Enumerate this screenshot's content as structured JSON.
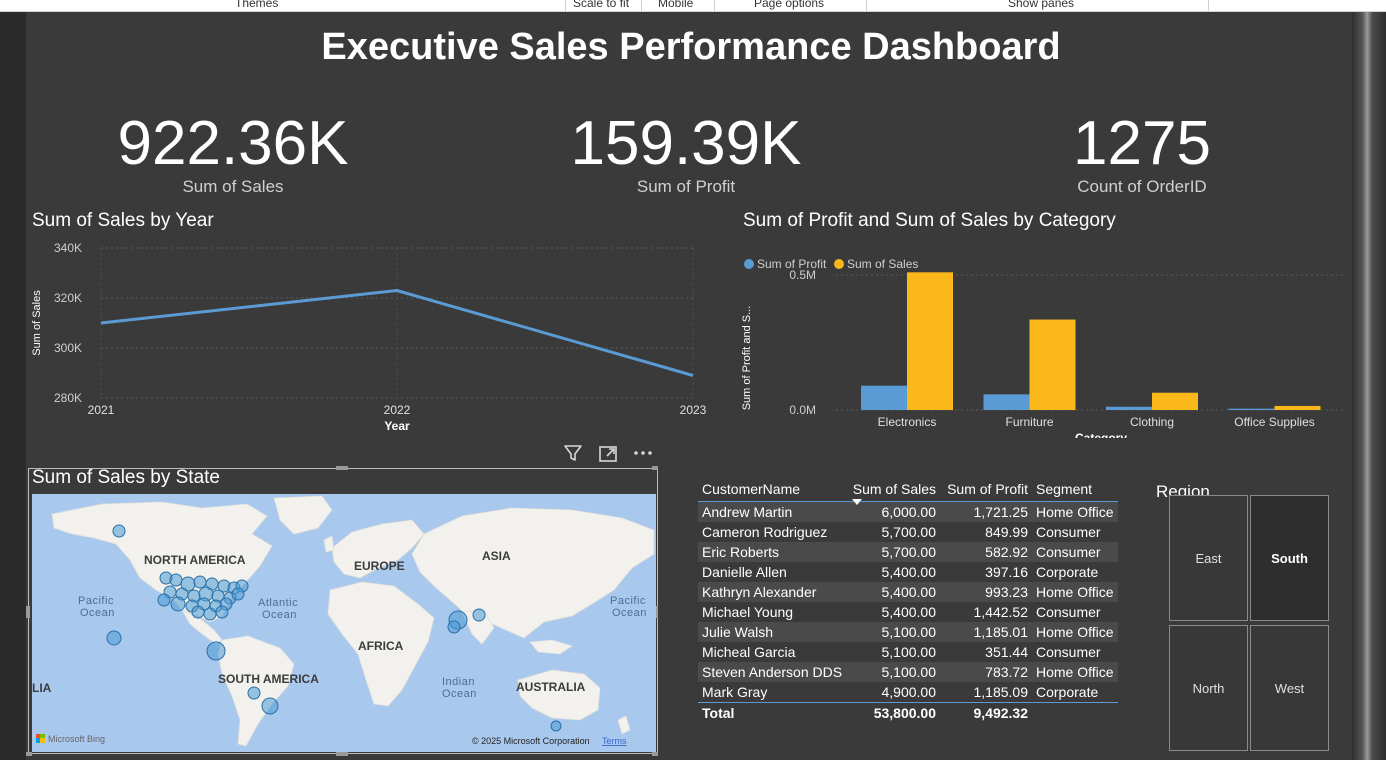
{
  "ribbon": {
    "items": [
      "Themes",
      "Scale to fit",
      "Mobile",
      "Page options",
      "Show panes"
    ]
  },
  "dashboard": {
    "title": "Executive Sales Performance Dashboard"
  },
  "kpis": [
    {
      "value": "922.36K",
      "label": "Sum of Sales"
    },
    {
      "value": "159.39K",
      "label": "Sum of Profit"
    },
    {
      "value": "1275",
      "label": "Count of OrderID"
    }
  ],
  "line_chart": {
    "title": "Sum of Sales by Year",
    "chart_data": {
      "type": "line",
      "x": [
        "2021",
        "2022",
        "2023"
      ],
      "series": [
        {
          "values": [
            310000,
            323000,
            289000
          ]
        }
      ],
      "xlabel": "Year",
      "ylabel": "Sum of Sales",
      "ylim": [
        280000,
        340000
      ],
      "yticks": [
        "340K",
        "320K",
        "300K",
        "280K"
      ],
      "grid": true,
      "color": "#5b9bd5"
    }
  },
  "bar_chart": {
    "title": "Sum of Profit and Sum of Sales by Category",
    "chart_data": {
      "type": "bar",
      "categories": [
        "Electronics",
        "Furniture",
        "Clothing",
        "Office Supplies"
      ],
      "series": [
        {
          "name": "Sum of Profit",
          "values": [
            90000,
            58000,
            12000,
            5000
          ],
          "color": "#5b9bd5"
        },
        {
          "name": "Sum of Sales",
          "values": [
            510000,
            335000,
            64000,
            15000
          ],
          "color": "#fbb81b"
        }
      ],
      "xlabel": "Category",
      "ylabel": "Sum of Profit and S...",
      "ylim": [
        0,
        600000
      ],
      "yticks": [
        "0.5M",
        "0.0M"
      ],
      "legend": "top-left"
    }
  },
  "visual_header": {
    "icons": [
      "filter-icon",
      "focus-mode-icon",
      "more-options-icon"
    ]
  },
  "map": {
    "title": "Sum of Sales by State",
    "labels": {
      "north_america": "NORTH AMERICA",
      "europe": "EUROPE",
      "asia": "ASIA",
      "africa": "AFRICA",
      "south_america": "SOUTH AMERICA",
      "australia": "AUSTRALIA",
      "pacific_left": "Pacific",
      "pacific_left2": "Ocean",
      "atlantic": "Atlantic",
      "atlantic2": "Ocean",
      "pacific_right": "Pacific",
      "pacific_right2": "Ocean",
      "indian": "Indian",
      "indian2": "Ocean",
      "lia": "LIA"
    },
    "attribution": "© 2025 Microsoft Corporation",
    "terms": "Terms",
    "brand": "Microsoft Bing",
    "bubble_color": "#4a9ad4"
  },
  "table": {
    "columns": [
      "CustomerName",
      "Sum of Sales",
      "Sum of Profit",
      "Segment"
    ],
    "rows": [
      [
        "Andrew Martin",
        "6,000.00",
        "1,721.25",
        "Home Office"
      ],
      [
        "Cameron Rodriguez",
        "5,700.00",
        "849.99",
        "Consumer"
      ],
      [
        "Eric Roberts",
        "5,700.00",
        "582.92",
        "Consumer"
      ],
      [
        "Danielle Allen",
        "5,400.00",
        "397.16",
        "Corporate"
      ],
      [
        "Kathryn Alexander",
        "5,400.00",
        "993.23",
        "Home Office"
      ],
      [
        "Michael Young",
        "5,400.00",
        "1,442.52",
        "Consumer"
      ],
      [
        "Julie Walsh",
        "5,100.00",
        "1,185.01",
        "Home Office"
      ],
      [
        "Micheal Garcia",
        "5,100.00",
        "351.44",
        "Consumer"
      ],
      [
        "Steven Anderson DDS",
        "5,100.00",
        "783.72",
        "Home Office"
      ],
      [
        "Mark Gray",
        "4,900.00",
        "1,185.09",
        "Corporate"
      ]
    ],
    "total": [
      "Total",
      "53,800.00",
      "9,492.32",
      ""
    ],
    "sorted_column": "Sum of Sales"
  },
  "slicer": {
    "title": "Region",
    "options": [
      {
        "label": "East",
        "selected": false
      },
      {
        "label": "South",
        "selected": true
      },
      {
        "label": "North",
        "selected": false
      },
      {
        "label": "West",
        "selected": false
      }
    ]
  }
}
